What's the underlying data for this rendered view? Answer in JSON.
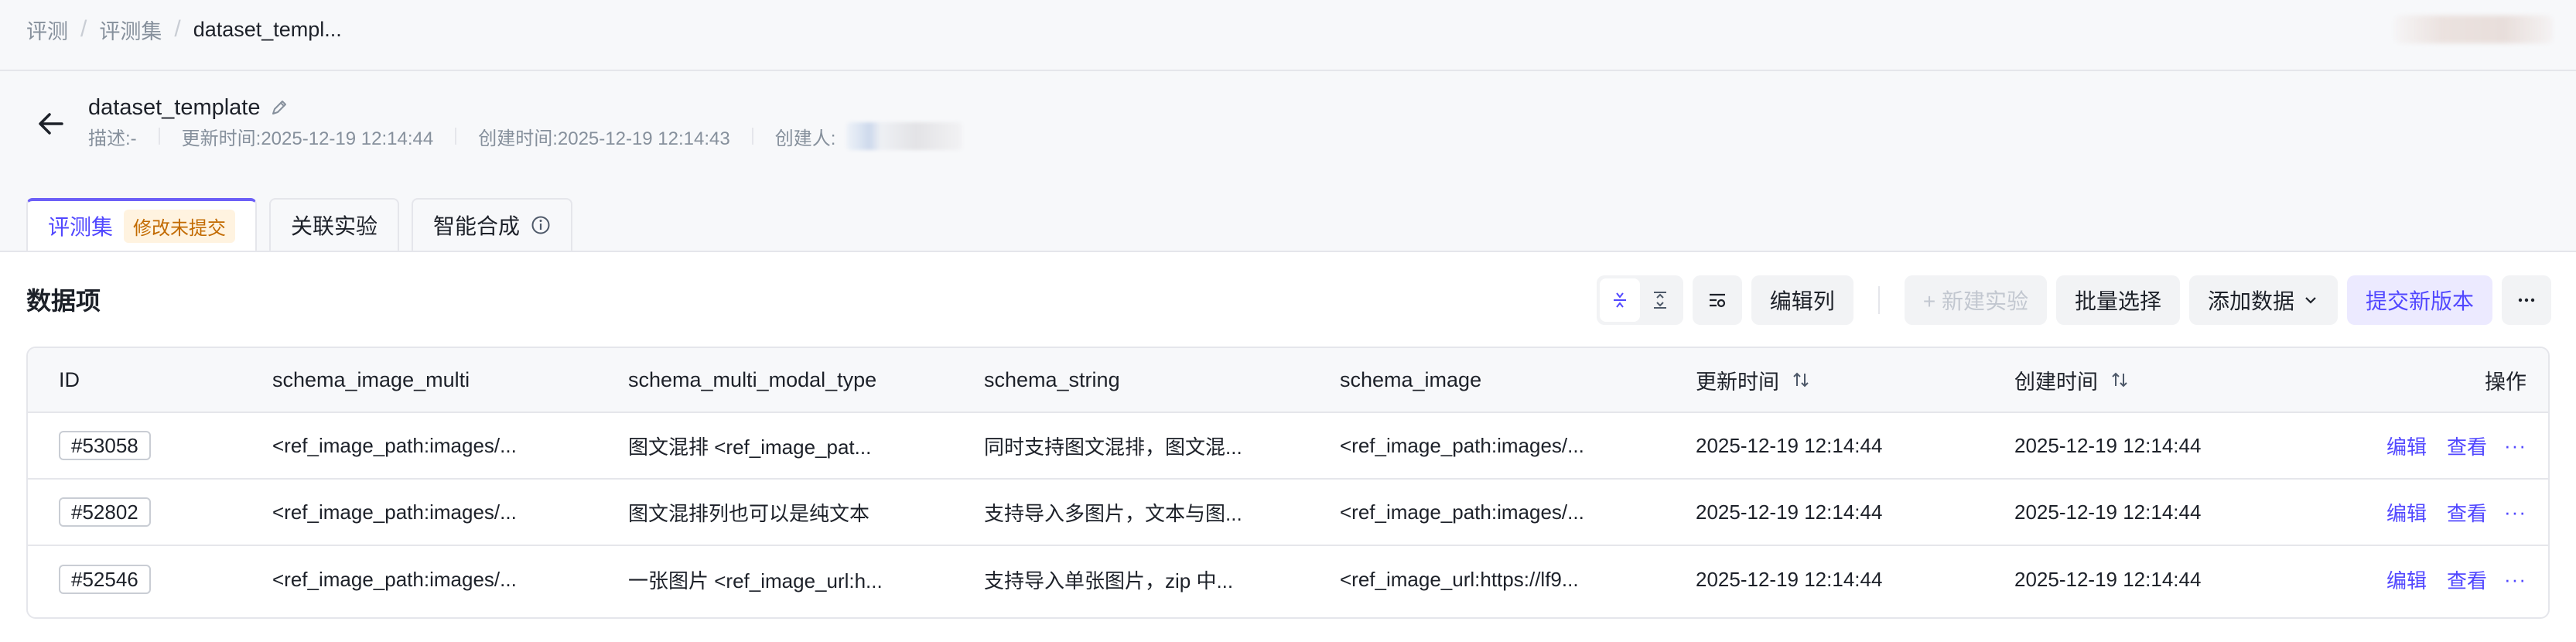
{
  "breadcrumb": [
    "评测",
    "评测集",
    "dataset_templ..."
  ],
  "header": {
    "title": "dataset_template",
    "meta": {
      "desc": "描述:-",
      "updated": "更新时间:2025-12-19 12:14:44",
      "created": "创建时间:2025-12-19 12:14:43",
      "creator_label": "创建人:"
    }
  },
  "tabs": [
    {
      "label": "评测集",
      "badge": "修改未提交"
    },
    {
      "label": "关联实验"
    },
    {
      "label": "智能合成"
    }
  ],
  "section": {
    "title": "数据项"
  },
  "toolbar": {
    "edit_columns": "编辑列",
    "new_experiment": "+ 新建实验",
    "batch_select": "批量选择",
    "add_data": "添加数据",
    "submit_version": "提交新版本"
  },
  "table": {
    "headers": [
      "ID",
      "schema_image_multi",
      "schema_multi_modal_type",
      "schema_string",
      "schema_image",
      "更新时间",
      "创建时间",
      "操作"
    ],
    "rows": [
      {
        "id": "#53058",
        "image_multi": "<ref_image_path:images/...",
        "multi_modal": "图文混排 <ref_image_pat...",
        "string": "同时支持图文混排，图文混...",
        "image": "<ref_image_path:images/...",
        "updated": "2025-12-19 12:14:44",
        "created": "2025-12-19 12:14:44"
      },
      {
        "id": "#52802",
        "image_multi": "<ref_image_path:images/...",
        "multi_modal": "图文混排列也可以是纯文本",
        "string": "支持导入多图片，文本与图...",
        "image": "<ref_image_path:images/...",
        "updated": "2025-12-19 12:14:44",
        "created": "2025-12-19 12:14:44"
      },
      {
        "id": "#52546",
        "image_multi": "<ref_image_path:images/...",
        "multi_modal": "一张图片 <ref_image_url:h...",
        "string": "支持导入单张图片，zip 中...",
        "image": "<ref_image_url:https://lf9...",
        "updated": "2025-12-19 12:14:44",
        "created": "2025-12-19 12:14:44"
      }
    ],
    "ops": {
      "edit": "编辑",
      "view": "查看",
      "more": "···"
    }
  },
  "icons": {
    "back": "arrow-left-icon",
    "edit_title": "pencil-icon",
    "info": "info-circle-icon",
    "collapse": "collapse-rows-icon",
    "expand": "expand-rows-icon",
    "filter": "filter-list-icon",
    "sort": "sort-arrows-icon",
    "dropdown": "chevron-down-icon",
    "more": "more-horizontal-icon"
  },
  "colors": {
    "accent": "#5147ff",
    "badge_text": "#c26a00",
    "badge_bg": "#fff3e0"
  }
}
